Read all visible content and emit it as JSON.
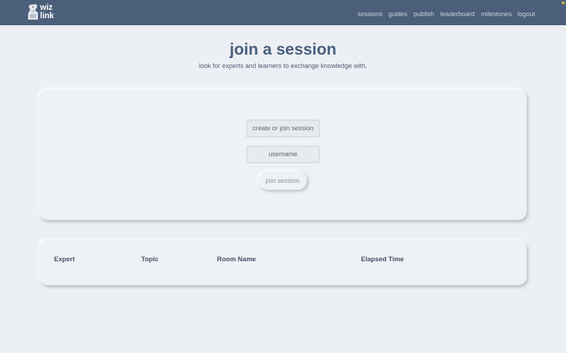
{
  "brand": {
    "line1": "wiz",
    "line2": "link"
  },
  "nav": {
    "items": [
      {
        "label": "sessions"
      },
      {
        "label": "guides"
      },
      {
        "label": "publish"
      },
      {
        "label": "leaderboard"
      },
      {
        "label": "milestones"
      },
      {
        "label": "logout"
      }
    ]
  },
  "page": {
    "title": "join a session",
    "subtitle": "look for experts and learners to exchange knowledge with."
  },
  "join_form": {
    "room_placeholder": "create or join session",
    "username_placeholder": "username",
    "join_label": "join session"
  },
  "sessions_table": {
    "columns": [
      "Expert",
      "Topic",
      "Room Name",
      "Elapsed Time"
    ],
    "rows": []
  },
  "colors": {
    "navbar": "#4b5f7a",
    "background": "#eceff3",
    "title": "#4a5f7d",
    "accent_dot": "#d4c04a"
  }
}
